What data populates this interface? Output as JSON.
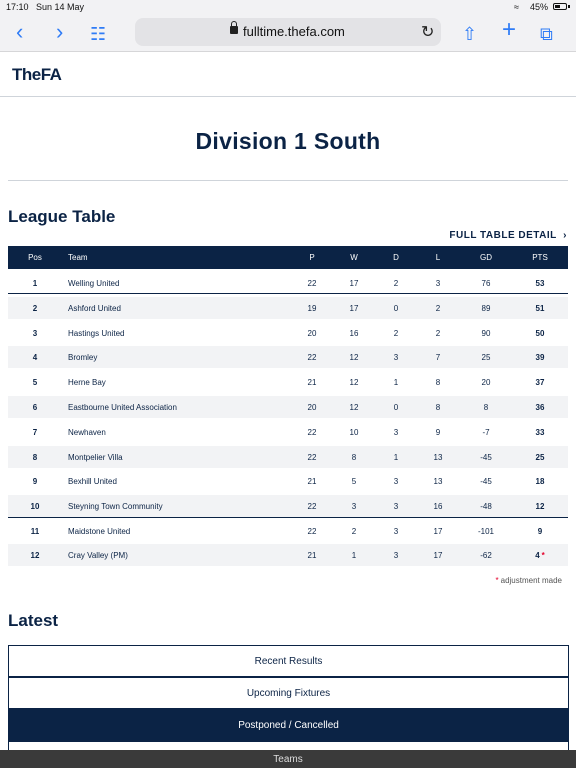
{
  "status": {
    "time": "17:10",
    "date": "Sun 14 May",
    "battery": "45%"
  },
  "browser": {
    "url": "fulltime.thefa.com"
  },
  "site": {
    "logo": "TheFA"
  },
  "page": {
    "title": "Division 1 South"
  },
  "league": {
    "heading": "League Table",
    "full_detail": "FULL TABLE DETAIL",
    "headers": {
      "pos": "Pos",
      "team": "Team",
      "p": "P",
      "w": "W",
      "d": "D",
      "l": "L",
      "gd": "GD",
      "pts": "PTS"
    },
    "rows": [
      {
        "pos": "1",
        "team": "Welling United",
        "p": "22",
        "w": "17",
        "d": "2",
        "l": "3",
        "gd": "76",
        "pts": "53",
        "star": ""
      },
      {
        "pos": "2",
        "team": "Ashford United",
        "p": "19",
        "w": "17",
        "d": "0",
        "l": "2",
        "gd": "89",
        "pts": "51",
        "star": ""
      },
      {
        "pos": "3",
        "team": "Hastings United",
        "p": "20",
        "w": "16",
        "d": "2",
        "l": "2",
        "gd": "90",
        "pts": "50",
        "star": ""
      },
      {
        "pos": "4",
        "team": "Bromley",
        "p": "22",
        "w": "12",
        "d": "3",
        "l": "7",
        "gd": "25",
        "pts": "39",
        "star": ""
      },
      {
        "pos": "5",
        "team": "Herne Bay",
        "p": "21",
        "w": "12",
        "d": "1",
        "l": "8",
        "gd": "20",
        "pts": "37",
        "star": ""
      },
      {
        "pos": "6",
        "team": "Eastbourne United Association",
        "p": "20",
        "w": "12",
        "d": "0",
        "l": "8",
        "gd": "8",
        "pts": "36",
        "star": ""
      },
      {
        "pos": "7",
        "team": "Newhaven",
        "p": "22",
        "w": "10",
        "d": "3",
        "l": "9",
        "gd": "-7",
        "pts": "33",
        "star": ""
      },
      {
        "pos": "8",
        "team": "Montpelier Villa",
        "p": "22",
        "w": "8",
        "d": "1",
        "l": "13",
        "gd": "-45",
        "pts": "25",
        "star": ""
      },
      {
        "pos": "9",
        "team": "Bexhill United",
        "p": "21",
        "w": "5",
        "d": "3",
        "l": "13",
        "gd": "-45",
        "pts": "18",
        "star": ""
      },
      {
        "pos": "10",
        "team": "Steyning Town Community",
        "p": "22",
        "w": "3",
        "d": "3",
        "l": "16",
        "gd": "-48",
        "pts": "12",
        "star": ""
      },
      {
        "pos": "11",
        "team": "Maidstone United",
        "p": "22",
        "w": "2",
        "d": "3",
        "l": "17",
        "gd": "-101",
        "pts": "9",
        "star": ""
      },
      {
        "pos": "12",
        "team": "Cray Valley (PM)",
        "p": "21",
        "w": "1",
        "d": "3",
        "l": "17",
        "gd": "-62",
        "pts": "4",
        "star": "*"
      }
    ],
    "adjustment_star": "*",
    "adjustment_note": "adjustment made"
  },
  "latest": {
    "heading": "Latest",
    "tabs": [
      {
        "label": "Recent Results",
        "active": false
      },
      {
        "label": "Upcoming Fixtures",
        "active": false
      },
      {
        "label": "Postponed / Cancelled",
        "active": true
      },
      {
        "label": "Teams",
        "active": false
      }
    ]
  },
  "colors": {
    "navy": "#0b2345",
    "accent_red": "#e4002b",
    "ios_blue": "#2f7cf6"
  }
}
